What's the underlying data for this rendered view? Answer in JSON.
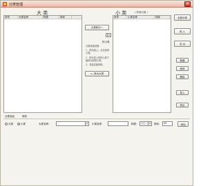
{
  "window": {
    "title": "分类管理"
  },
  "big_category": {
    "heading": "大 类",
    "columns": [
      "序号",
      "大类名称",
      "种类",
      "排序"
    ]
  },
  "small_category": {
    "heading": "小 类",
    "filter_label": "( 所有分类 )",
    "columns": [
      "序号",
      "小类名称",
      "排序"
    ]
  },
  "middle": {
    "all_to_big_button": "大类转为一",
    "note_title": "的小类",
    "note_lines": [
      "分类转换说明：",
      "1、把勾选上，点击选择小类。",
      "2、把分类上的的小类下级转为到的小类。",
      "3、将选定能转换。"
    ],
    "convert_button": "<--转为大类"
  },
  "right_toolbar": {
    "all_categories": "全部分类",
    "receive": "收 入",
    "expense": "支 出",
    "new": "新建",
    "edit": "修改",
    "delete": "删除",
    "import": "导入",
    "export": "导出"
  },
  "bottom": {
    "section_label": "分类添加",
    "section_sub": "修改",
    "radio_big": "大类",
    "radio_small": "小类",
    "big_name_label": "大类名称：",
    "small_name_label": "小类名称：",
    "kind_label": "种类：",
    "kind_value": "支出",
    "order_label": "排序：",
    "order_value": "99",
    "add_button": "添加"
  }
}
